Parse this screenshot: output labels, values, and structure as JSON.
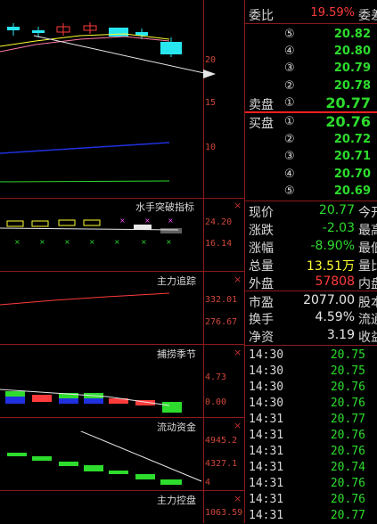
{
  "main_axis": {
    "labels": [
      "20",
      "15",
      "10"
    ]
  },
  "panels": [
    {
      "title": "水手突破指标",
      "close": "×",
      "axis": [
        "24.20",
        "16.14"
      ]
    },
    {
      "title": "主力追踪",
      "close": "×",
      "axis": [
        "332.01",
        "276.67"
      ]
    },
    {
      "title": "捕捞季节",
      "close": "×",
      "axis": [
        "4.73",
        "0.00"
      ]
    },
    {
      "title": "流动资金",
      "close": "×",
      "axis": [
        "4945.2",
        "4327.1",
        "4"
      ]
    },
    {
      "title": "主力控盘",
      "close": "×",
      "axis": [
        "1063.59"
      ]
    }
  ],
  "quote": {
    "weibi": {
      "label": "委比",
      "value": "19.59%",
      "tail": "委差"
    },
    "sell": [
      {
        "label": "",
        "num": "⑤",
        "price": "20.82"
      },
      {
        "label": "",
        "num": "④",
        "price": "20.80"
      },
      {
        "label": "",
        "num": "③",
        "price": "20.79"
      },
      {
        "label": "",
        "num": "②",
        "price": "20.78"
      },
      {
        "label": "卖盘",
        "num": "①",
        "price": "20.77"
      }
    ],
    "buy": [
      {
        "label": "买盘",
        "num": "①",
        "price": "20.76"
      },
      {
        "label": "",
        "num": "②",
        "price": "20.72"
      },
      {
        "label": "",
        "num": "③",
        "price": "20.71"
      },
      {
        "label": "",
        "num": "④",
        "price": "20.70"
      },
      {
        "label": "",
        "num": "⑤",
        "price": "20.69"
      }
    ],
    "stats": [
      {
        "label": "现价",
        "value": "20.77",
        "tail": "今开",
        "color": "green"
      },
      {
        "label": "涨跌",
        "value": "-2.03",
        "tail": "最高",
        "color": "green"
      },
      {
        "label": "涨幅",
        "value": "-8.90%",
        "tail": "最低",
        "color": "green"
      },
      {
        "label": "总量",
        "value": "13.51万",
        "tail": "量比",
        "color": "yellow"
      },
      {
        "label": "外盘",
        "value": "57808",
        "tail": "内盘",
        "color": "red"
      },
      {
        "label": "市盈",
        "value": "2077.00",
        "tail": "股本",
        "color": "white"
      },
      {
        "label": "换手",
        "value": "4.59%",
        "tail": "流通",
        "color": "white"
      },
      {
        "label": "净资",
        "value": "3.19",
        "tail": "收益",
        "color": "white"
      }
    ],
    "ticks": [
      {
        "time": "14:30",
        "price": "20.75"
      },
      {
        "time": "14:30",
        "price": "20.75"
      },
      {
        "time": "14:30",
        "price": "20.76"
      },
      {
        "time": "14:30",
        "price": "20.76"
      },
      {
        "time": "14:31",
        "price": "20.77"
      },
      {
        "time": "14:31",
        "price": "20.76"
      },
      {
        "time": "14:31",
        "price": "20.76"
      },
      {
        "time": "14:31",
        "price": "20.74"
      },
      {
        "time": "14:31",
        "price": "20.76"
      },
      {
        "time": "14:31",
        "price": "20.76"
      },
      {
        "time": "14:31",
        "price": "20.77"
      }
    ]
  },
  "colors": {
    "up": "#ff3b3b",
    "down": "#2ddc2d",
    "grid": "#8b1a1a",
    "cyan": "#27e6f0"
  }
}
